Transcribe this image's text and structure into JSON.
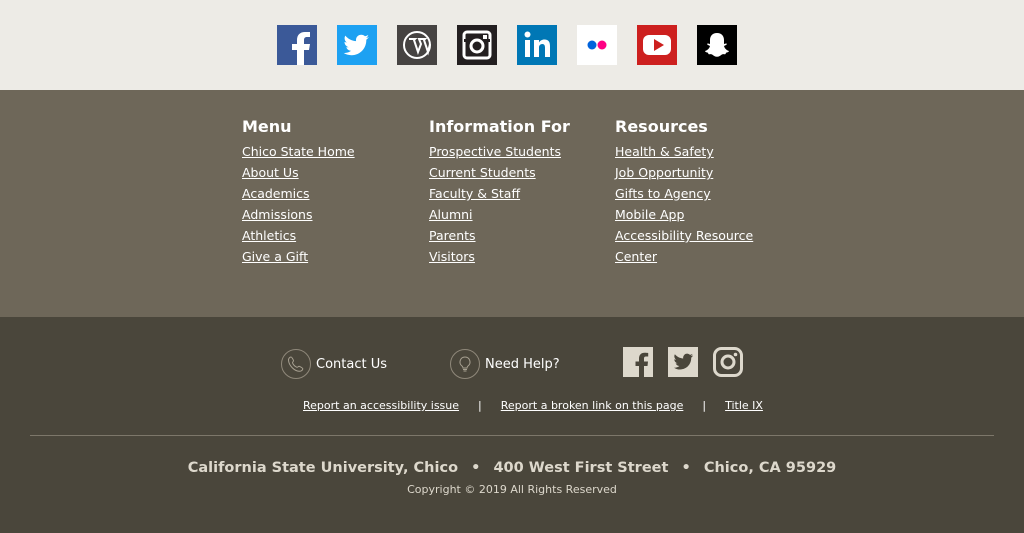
{
  "social_icons": [
    {
      "name": "facebook-icon",
      "color": "#3b5998"
    },
    {
      "name": "twitter-icon",
      "color": "#1da1f2"
    },
    {
      "name": "wordpress-icon",
      "color": "#464342"
    },
    {
      "name": "instagram-icon",
      "color": "#231f20"
    },
    {
      "name": "linkedin-icon",
      "color": "#0077b5"
    },
    {
      "name": "flickr-icon",
      "color": "#ffffff"
    },
    {
      "name": "youtube-icon",
      "color": "#cd201f"
    },
    {
      "name": "snapchat-icon",
      "color": "#000000"
    }
  ],
  "footer_columns": {
    "menu": {
      "heading": "Menu",
      "links": [
        "Chico State Home",
        "About Us",
        "Academics",
        "Admissions",
        "Athletics",
        "Give a Gift"
      ]
    },
    "information_for": {
      "heading": "Information For",
      "links": [
        "Prospective Students",
        "Current Students",
        "Faculty & Staff",
        "Alumni",
        "Parents",
        "Visitors"
      ]
    },
    "resources": {
      "heading": "Resources",
      "links": [
        "Health & Safety",
        "Job Opportunity",
        "Gifts to Agency",
        "Mobile App",
        "Accessibility Resource",
        "Center"
      ]
    }
  },
  "help": {
    "contact_label": "Contact Us",
    "need_help_label": "Need Help?"
  },
  "bottom_social": [
    "facebook-icon",
    "twitter-icon",
    "instagram-icon"
  ],
  "utility_links": {
    "accessibility": "Report an accessibility issue",
    "broken_link": "Report a broken link on this page",
    "title_ix": "Title IX",
    "separator": "|"
  },
  "address": {
    "institution": "California State University, Chico",
    "street": "400 West First Street",
    "city": "Chico, CA 95929",
    "dot": "•"
  },
  "copyright": "Copyright © 2019 All Rights Reserved",
  "colors": {
    "top_band": "#edebe6",
    "links_band": "#6e6759",
    "bottom_band": "#4a463b"
  }
}
